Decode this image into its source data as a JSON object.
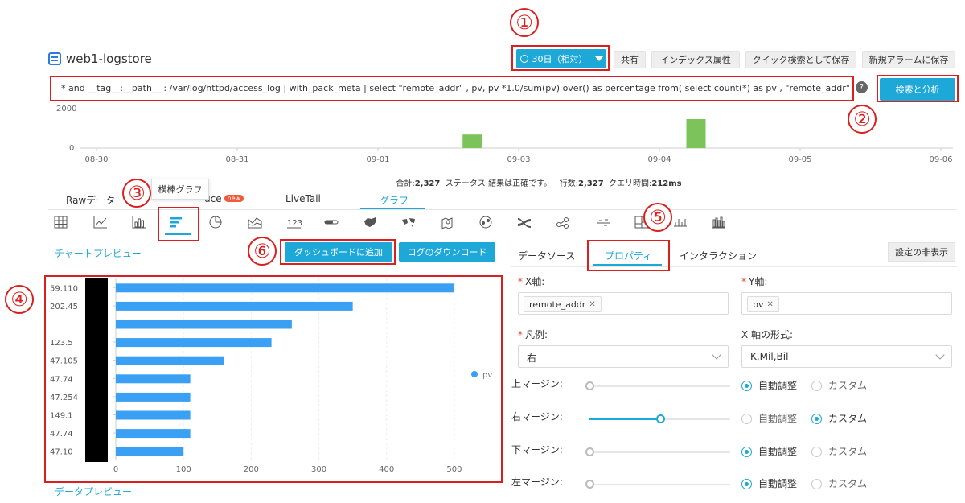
{
  "header": {
    "title": "web1-logstore",
    "time_button": "30日（相対）",
    "actions": [
      "共有",
      "インデックス属性",
      "クイック検索として保存",
      "新規アラームに保存"
    ]
  },
  "query": {
    "text": "* and __tag__:__path__ : /var/log/httpd/access_log | with_pack_meta | select \"remote_addr\" , pv, pv *1.0/sum(pv) over() as percentage from( select count(*) as pv , \"remote_addr\" from (select \"",
    "help": "?",
    "search_button": "検索と分析"
  },
  "histogram": {
    "y_ticks": [
      "2000",
      "0"
    ],
    "x_ticks": [
      "08-30",
      "08-31",
      "09-01",
      "09-03",
      "09-04",
      "09-05",
      "09-06"
    ],
    "bars": [
      {
        "position": 0.445,
        "value": 700
      },
      {
        "position": 0.71,
        "value": 1500
      }
    ],
    "bar_color": "#7cc35a"
  },
  "summary": {
    "total_label": "合計:",
    "total": "2,327",
    "status_label": "ステータス:",
    "status": "結果は正確です。",
    "rows_label": "行数:",
    "rows": "2,327",
    "time_label": "クエリ時間:",
    "time": "212ms"
  },
  "tabs": {
    "raw": "Rawデータ",
    "logreduce": "uce",
    "new_badge": "new",
    "livetail": "LiveTail",
    "graph": "グラフ"
  },
  "tooltip": "横棒グラフ",
  "chart_icons": [
    "table-icon",
    "line-chart-icon",
    "column-chart-icon",
    "bar-chart-icon",
    "pie-chart-icon",
    "area-chart-icon",
    "number-icon",
    "progress-icon",
    "map-china-icon",
    "world-map-icon",
    "amap-icon",
    "flow-icon",
    "sankey-icon",
    "word-cloud-icon",
    "marker-icon",
    "treemap-icon",
    "timeline-icon",
    "histogram-icon"
  ],
  "preview": {
    "chart_title": "チャートプレビュー",
    "add_dashboard": "ダッシュボードに追加",
    "download_log": "ログのダウンロード",
    "data_title": "データプレビュー"
  },
  "chart_data": {
    "type": "bar",
    "orientation": "horizontal",
    "categories": [
      "59.110",
      "202.45",
      "",
      "123.5",
      "47.105",
      "47.74",
      "47.254",
      "149.1",
      "47.74",
      "47.10"
    ],
    "series": [
      {
        "name": "pv",
        "values": [
          500,
          350,
          260,
          230,
          160,
          110,
          110,
          110,
          110,
          100
        ]
      }
    ],
    "x_ticks": [
      "0",
      "100",
      "200",
      "300",
      "400",
      "500"
    ],
    "xlim": [
      0,
      550
    ],
    "color": "#3aa0f3",
    "legend": "right"
  },
  "panel": {
    "tabs": [
      "データソース",
      "プロパティ",
      "インタラクション"
    ],
    "hide_button": "設定の非表示",
    "x_axis_label": "X軸:",
    "x_axis_value": "remote_addr",
    "y_axis_label": "Y軸:",
    "y_axis_value": "pv",
    "legend_label": "凡例:",
    "legend_value": "右",
    "format_label": "X 軸の形式:",
    "format_value": "K,Mil,Bil",
    "margins": [
      {
        "label": "上マージン:",
        "value": 0,
        "mode": "auto"
      },
      {
        "label": "右マージン:",
        "value": 0.5,
        "mode": "custom"
      },
      {
        "label": "下マージン:",
        "value": 0,
        "mode": "auto"
      },
      {
        "label": "左マージン:",
        "value": 0,
        "mode": "auto"
      }
    ],
    "auto_label": "自動調整",
    "custom_label": "カスタム"
  },
  "markers": [
    "①",
    "②",
    "③",
    "④",
    "⑤",
    "⑥"
  ]
}
